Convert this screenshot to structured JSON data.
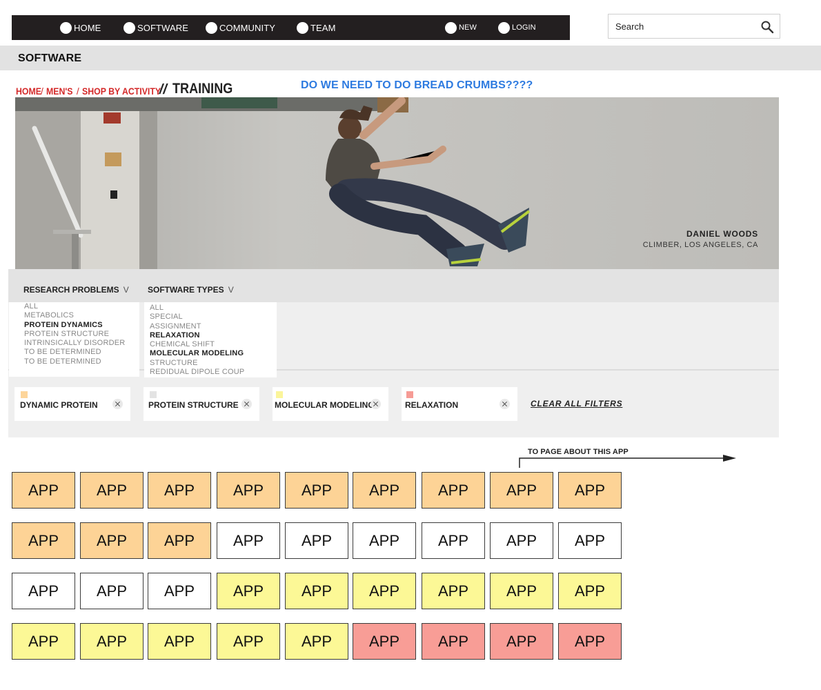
{
  "nav": {
    "items": [
      {
        "label": "HOME"
      },
      {
        "label": "SOFTWARE"
      },
      {
        "label": "COMMUNITY"
      },
      {
        "label": "TEAM"
      },
      {
        "label": "NEW"
      },
      {
        "label": "LOGIN"
      }
    ]
  },
  "search": {
    "placeholder": "Search",
    "icon": "search-icon"
  },
  "section": {
    "title": "SOFTWARE"
  },
  "breadcrumb": {
    "items": [
      "HOME",
      "MEN'S",
      "SHOP BY ACTIVITY"
    ],
    "separator": "/",
    "current_separator": "//",
    "current": "TRAINING"
  },
  "note": "DO WE NEED TO DO BREAD CRUMBS????",
  "hero": {
    "name": "DANIEL WOODS",
    "subtitle": "CLIMBER, LOS ANGELES, CA"
  },
  "filters": {
    "research": {
      "label": "RESEARCH PROBLEMS",
      "chevron": "V",
      "options": [
        {
          "label": "ALL",
          "selected": false
        },
        {
          "label": "METABOLICS",
          "selected": false
        },
        {
          "label": "PROTEIN DYNAMICS",
          "selected": true
        },
        {
          "label": "PROTEIN STRUCTURE",
          "selected": false
        },
        {
          "label": "INTRINSICALLY DISORDER",
          "selected": false
        },
        {
          "label": "TO BE DETERMINED",
          "selected": false
        },
        {
          "label": "TO BE DETERMINED",
          "selected": false
        }
      ]
    },
    "software": {
      "label": "SOFTWARE TYPES",
      "chevron": "V",
      "options": [
        {
          "label": "ALL",
          "selected": false
        },
        {
          "label": "SPECIAL",
          "selected": false
        },
        {
          "label": "ASSIGNMENT",
          "selected": false
        },
        {
          "label": "RELAXATION",
          "selected": true
        },
        {
          "label": "CHEMICAL SHIFT",
          "selected": false
        },
        {
          "label": "MOLECULAR MODELING",
          "selected": true
        },
        {
          "label": "STRUCTURE",
          "selected": false
        },
        {
          "label": "REDIDUAL DIPOLE COUP",
          "selected": false
        }
      ]
    },
    "chips": [
      {
        "label": "DYNAMIC PROTEIN",
        "color": "#fdd59a"
      },
      {
        "label": "PROTEIN STRUCTURE",
        "color": "#e3e3e3"
      },
      {
        "label": "MOLECULAR MODELING",
        "color": "#fbf59a"
      },
      {
        "label": "RELAXATION",
        "color": "#f69b95"
      }
    ],
    "clear_all": "CLEAR ALL FILTERS"
  },
  "annotation": "TO PAGE ABOUT THIS APP",
  "colors": {
    "orange": "#fdd396",
    "white": "#ffffff",
    "yellow": "#fcf896",
    "red": "#f89d96",
    "nav_bg": "#231f20",
    "accent_red": "#d42a2a",
    "note_blue": "#2e7be0"
  },
  "apps": {
    "label": "APP",
    "rows": [
      [
        "orange",
        "orange",
        "orange",
        "orange",
        "orange",
        "orange",
        "orange",
        "orange",
        "orange"
      ],
      [
        "orange",
        "orange",
        "orange",
        "white",
        "white",
        "white",
        "white",
        "white",
        "white"
      ],
      [
        "white",
        "white",
        "white",
        "yellow",
        "yellow",
        "yellow",
        "yellow",
        "yellow",
        "yellow"
      ],
      [
        "yellow",
        "yellow",
        "yellow",
        "yellow",
        "yellow",
        "red",
        "red",
        "red",
        "red"
      ]
    ]
  }
}
